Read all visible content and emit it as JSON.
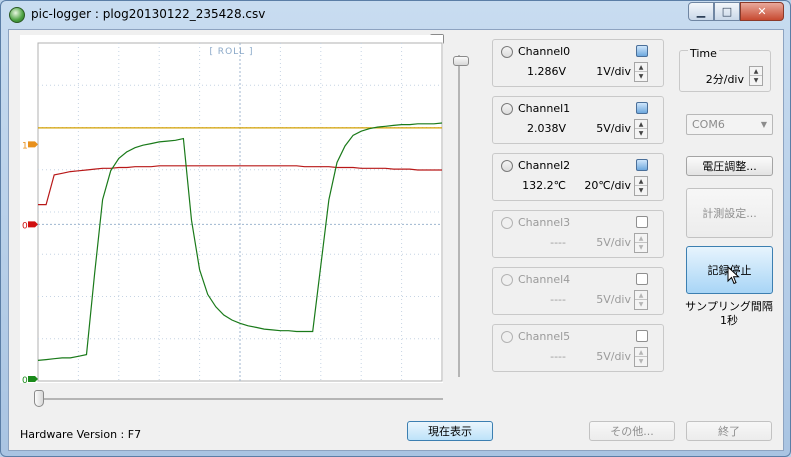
{
  "window": {
    "title": "pic-logger : plog20130122_235428.csv",
    "min_icon": "▁",
    "max_icon": "□",
    "close_icon": "✕"
  },
  "plot": {
    "mode_label": "[ ROLL ]",
    "markers": [
      {
        "label": "1",
        "color": "#e8901c"
      },
      {
        "label": "0",
        "color": "#d01010"
      },
      {
        "label": "0",
        "color": "#1a8a1a"
      }
    ]
  },
  "chart_data": {
    "type": "line",
    "x": [
      0,
      1,
      2,
      3,
      4,
      5,
      6,
      7,
      8,
      9,
      10,
      11,
      12,
      13,
      14,
      15,
      16,
      17,
      18,
      19,
      20,
      21,
      22,
      23,
      24,
      25,
      26,
      27,
      28,
      29,
      30,
      31,
      32,
      33,
      34,
      35,
      36,
      37,
      38,
      39,
      40,
      41,
      42,
      43,
      44,
      45,
      46,
      47,
      48,
      49,
      50
    ],
    "ylim": [
      -1.9,
      2.2
    ],
    "grid": true,
    "series": [
      {
        "color": "#d4a000",
        "values": [
          1.17,
          1.17,
          1.17,
          1.17,
          1.17,
          1.17,
          1.17,
          1.17,
          1.17,
          1.17,
          1.17,
          1.17,
          1.17,
          1.17,
          1.17,
          1.17,
          1.17,
          1.17,
          1.17,
          1.17,
          1.17,
          1.17,
          1.17,
          1.17,
          1.17,
          1.17,
          1.17,
          1.17,
          1.17,
          1.17,
          1.17,
          1.17,
          1.17,
          1.17,
          1.17,
          1.17,
          1.17,
          1.17,
          1.17,
          1.17,
          1.17,
          1.17,
          1.17,
          1.17,
          1.17,
          1.17,
          1.17,
          1.17,
          1.17,
          1.17,
          1.17
        ]
      },
      {
        "color": "#b81818",
        "values": [
          0.24,
          0.24,
          0.6,
          0.62,
          0.64,
          0.65,
          0.66,
          0.67,
          0.68,
          0.68,
          0.69,
          0.69,
          0.7,
          0.7,
          0.7,
          0.71,
          0.71,
          0.71,
          0.71,
          0.71,
          0.71,
          0.71,
          0.71,
          0.71,
          0.71,
          0.71,
          0.71,
          0.71,
          0.71,
          0.71,
          0.71,
          0.71,
          0.71,
          0.7,
          0.7,
          0.7,
          0.7,
          0.69,
          0.69,
          0.69,
          0.68,
          0.68,
          0.68,
          0.68,
          0.67,
          0.67,
          0.67,
          0.66,
          0.66,
          0.66,
          0.66
        ]
      },
      {
        "color": "#1a7a1a",
        "values": [
          -1.65,
          -1.64,
          -1.63,
          -1.62,
          -1.62,
          -1.6,
          -1.58,
          -0.6,
          0.3,
          0.65,
          0.8,
          0.88,
          0.93,
          0.96,
          0.98,
          1.0,
          1.01,
          1.02,
          1.04,
          0.05,
          -0.55,
          -0.85,
          -1.0,
          -1.1,
          -1.16,
          -1.2,
          -1.23,
          -1.25,
          -1.27,
          -1.28,
          -1.29,
          -1.29,
          -1.3,
          -1.3,
          -1.3,
          -0.5,
          0.3,
          0.75,
          0.95,
          1.08,
          1.13,
          1.16,
          1.18,
          1.19,
          1.2,
          1.21,
          1.21,
          1.22,
          1.22,
          1.22,
          1.23
        ]
      }
    ]
  },
  "channels": [
    {
      "name": "Channel0",
      "value": "1.286V",
      "scale": "1V/div",
      "enabled": true
    },
    {
      "name": "Channel1",
      "value": "2.038V",
      "scale": "5V/div",
      "enabled": true
    },
    {
      "name": "Channel2",
      "value": "132.2℃",
      "scale": "20℃/div",
      "enabled": true
    },
    {
      "name": "Channel3",
      "value": "----",
      "scale": "5V/div",
      "enabled": false
    },
    {
      "name": "Channel4",
      "value": "----",
      "scale": "5V/div",
      "enabled": false
    },
    {
      "name": "Channel5",
      "value": "----",
      "scale": "5V/div",
      "enabled": false
    }
  ],
  "time": {
    "label": "Time",
    "value": "2分/div"
  },
  "port": {
    "selected": "COM6"
  },
  "buttons": {
    "voltage_adjust": "電圧調整...",
    "measure_settings": "計測設定...",
    "stop_recording": "記録停止",
    "current_display": "現在表示",
    "other": "その他...",
    "exit": "終了"
  },
  "sampling": {
    "label": "サンプリング間隔",
    "value": "1秒"
  },
  "hardware": {
    "label": "Hardware Version :",
    "value": "F7"
  },
  "spinner": {
    "up": "▲",
    "down": "▼"
  },
  "combo_arrow": "▼"
}
